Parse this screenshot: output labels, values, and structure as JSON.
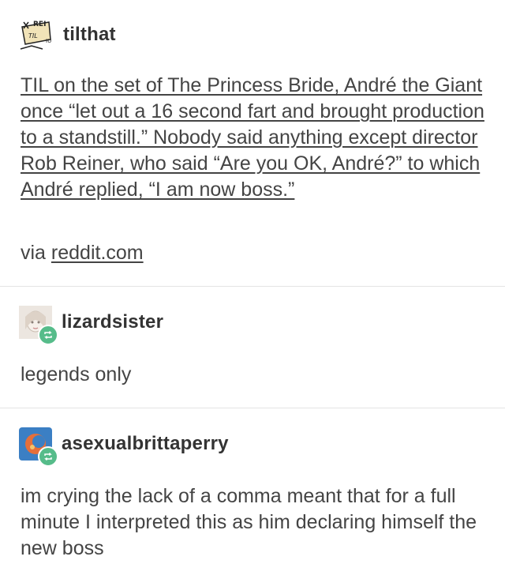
{
  "post1": {
    "username": "tilthat",
    "body": "TIL on the set of The Princess Bride, André the Giant once “let out a 16 second fart and brought production to a standstill.” Nobody said anything except director Rob Reiner, who said “Are you OK, André?” to which André replied, “I am now boss.”",
    "via_prefix": "via ",
    "via_link": "reddit.com",
    "avatar_text_top": "REI",
    "avatar_text_mid": "TIL",
    "avatar_text_small": "IU"
  },
  "post2": {
    "username": "lizardsister",
    "body": "legends only"
  },
  "post3": {
    "username": "asexualbrittaperry",
    "body": "im crying the lack of a comma meant that for a full minute I interpreted this as him declaring himself the new boss"
  },
  "colors": {
    "reblog_badge": "#56bc8a",
    "text": "#444444",
    "divider": "#e4e4e4"
  }
}
